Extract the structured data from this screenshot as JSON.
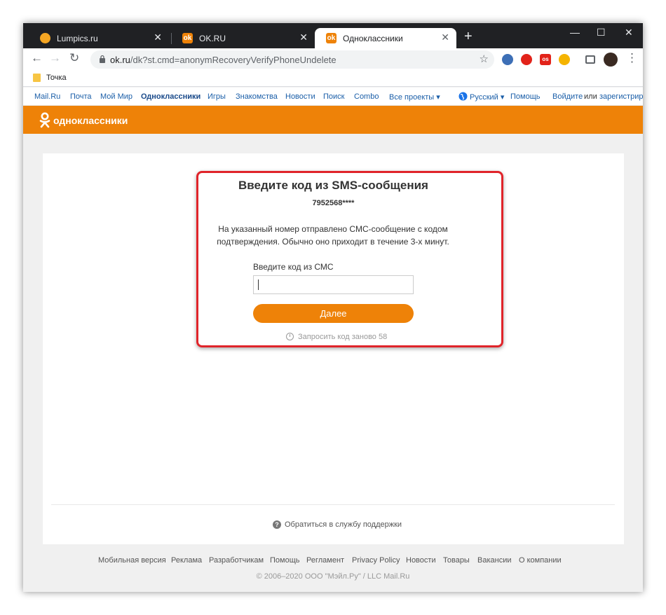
{
  "tabs": [
    {
      "title": "Lumpics.ru",
      "close": "✕"
    },
    {
      "title": "OK.RU",
      "close": "✕"
    },
    {
      "title": "Одноклассники",
      "close": "✕"
    }
  ],
  "new_tab": "+",
  "window_controls": {
    "minimize": "—",
    "maximize": "☐",
    "close": "✕"
  },
  "toolbar": {
    "back": "←",
    "forward": "→",
    "reload": "↻",
    "url_host": "ok.ru",
    "url_path": "/dk?st.cmd=anonymRecoveryVerifyPhoneUndelete",
    "star": "☆",
    "menu": "⋮"
  },
  "bookmarks": [
    {
      "label": "Точка"
    }
  ],
  "portal_nav": {
    "items": [
      "Mail.Ru",
      "Почта",
      "Мой Мир",
      "Одноклассники",
      "Игры",
      "Знакомства",
      "Новости",
      "Поиск",
      "Combo",
      "Все проекты ▾"
    ],
    "language": "Русский ▾",
    "help": "Помощь",
    "login": "Войдите",
    "or": "или",
    "register": "зарегистриру"
  },
  "brand": {
    "name": "одноклассники",
    "color": "#ee8208"
  },
  "verify": {
    "title": "Введите код из SMS-сообщения",
    "phone": "7952568****",
    "description": "На указанный номер отправлено СМС-сообщение с кодом подтверждения. Обычно оно приходит в течение 3-х минут.",
    "code_label": "Введите код из СМС",
    "code_value": "",
    "submit": "Далее",
    "resend": "Запросить код заново 58"
  },
  "support": {
    "label": "Обратиться в службу поддержки"
  },
  "footer": {
    "links": [
      "Мобильная версия",
      "Реклама",
      "Разработчикам",
      "Помощь",
      "Регламент",
      "Privacy Policy",
      "Новости",
      "Товары",
      "Вакансии",
      "О компании"
    ],
    "copyright": "© 2006–2020 ООО \"Мэйл.Ру\" / LLC Mail.Ru"
  },
  "colors": {
    "accent": "#ee8208",
    "highlight": "#e0242a",
    "link": "#1a5ea8"
  },
  "icons": [
    "search-icon",
    "lock-icon",
    "star-icon",
    "folder-icon",
    "globe-icon",
    "clock-icon",
    "question-icon"
  ]
}
